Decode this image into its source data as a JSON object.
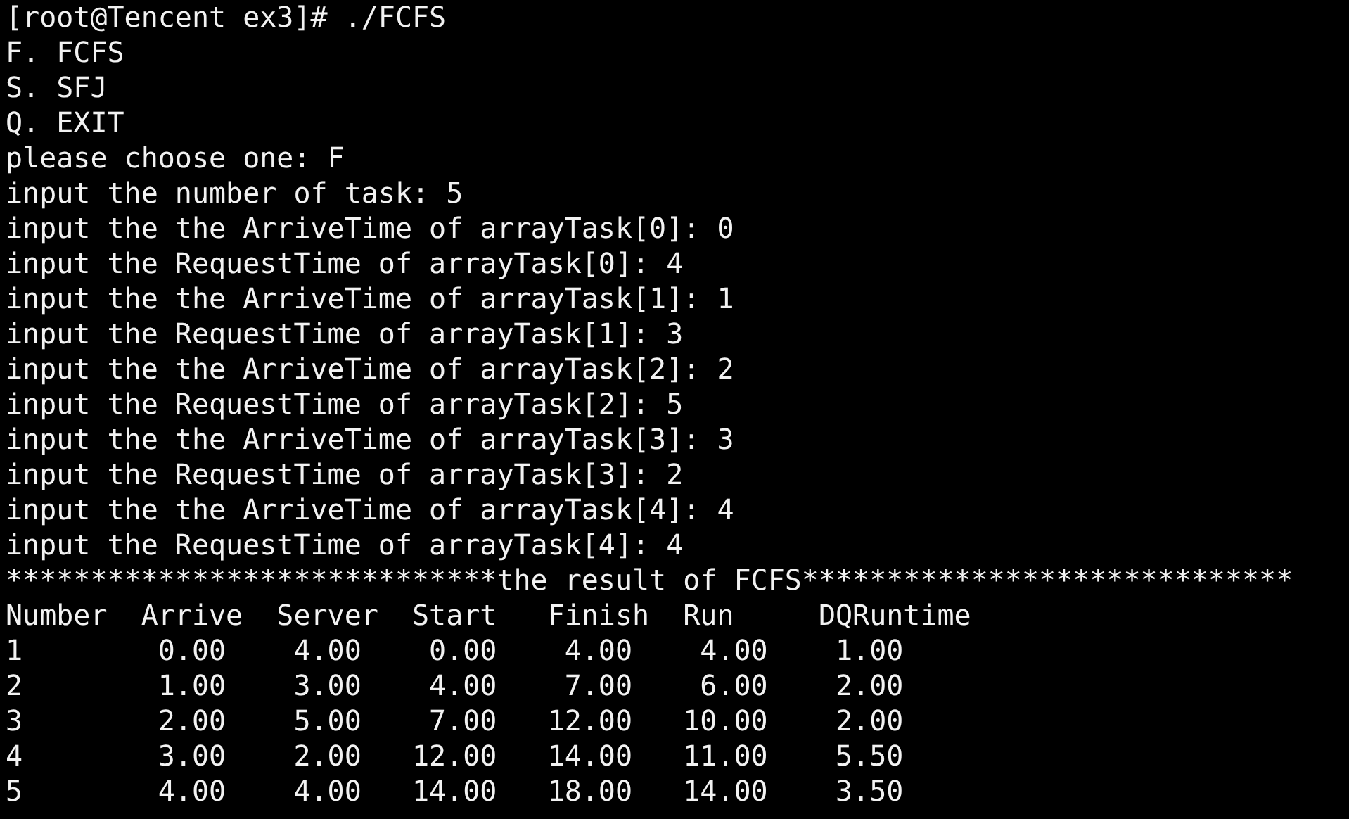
{
  "terminal": {
    "lines": [
      "[root@Tencent ex3]# ./FCFS",
      "F. FCFS",
      "S. SFJ",
      "Q. EXIT",
      "please choose one: F",
      "input the number of task: 5",
      "input the the ArriveTime of arrayTask[0]: 0",
      "input the RequestTime of arrayTask[0]: 4",
      "input the the ArriveTime of arrayTask[1]: 1",
      "input the RequestTime of arrayTask[1]: 3",
      "input the the ArriveTime of arrayTask[2]: 2",
      "input the RequestTime of arrayTask[2]: 5",
      "input the the ArriveTime of arrayTask[3]: 3",
      "input the RequestTime of arrayTask[3]: 2",
      "input the the ArriveTime of arrayTask[4]: 4",
      "input the RequestTime of arrayTask[4]: 4",
      "*****************************the result of FCFS*****************************",
      "Number  Arrive  Server  Start   Finish  Run     DQRuntime",
      "1        0.00    4.00    0.00    4.00    4.00    1.00",
      "2        1.00    3.00    4.00    7.00    6.00    2.00",
      "3        2.00    5.00    7.00   12.00   10.00    2.00",
      "4        3.00    2.00   12.00   14.00   11.00    5.50",
      "5        4.00    4.00   14.00   18.00   14.00    3.50"
    ]
  }
}
